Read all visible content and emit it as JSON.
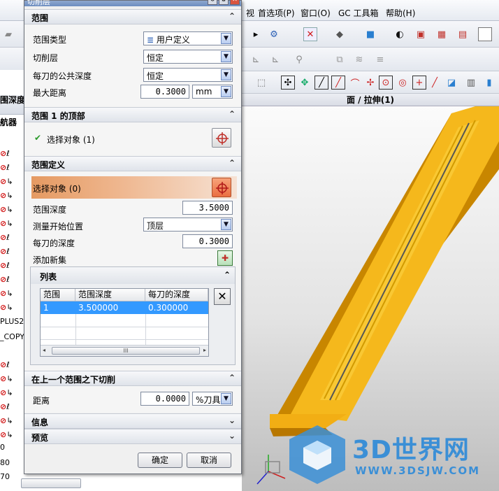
{
  "menubar": {
    "items": [
      "视",
      "首选项(P)",
      "窗口(O)",
      "GC 工具箱",
      "帮助(H)"
    ]
  },
  "view_title": "面 / 拉伸(1)",
  "navigator": {
    "tab1": "围深度",
    "tab2": "航器",
    "frag_plus": "PLUS2",
    "frag_copy": "_COPY",
    "num_a": "0",
    "num_b": "80",
    "num_c": "70"
  },
  "dialog": {
    "title": "切削层",
    "sections": {
      "range": {
        "title": "范围",
        "range_type_label": "范围类型",
        "range_type_value": "用户定义",
        "cut_layer_label": "切削层",
        "cut_layer_value": "恒定",
        "common_depth_label": "每刀的公共深度",
        "common_depth_value": "恒定",
        "max_distance_label": "最大距离",
        "max_distance_value": "0.3000",
        "max_distance_unit": "mm"
      },
      "range1_top": {
        "title": "范围 1 的顶部",
        "select_label": "选择对象 (1)"
      },
      "range_def": {
        "title": "范围定义",
        "select_label": "选择对象 (0)",
        "range_depth_label": "范围深度",
        "range_depth_value": "3.5000",
        "measure_from_label": "测量开始位置",
        "measure_from_value": "顶层",
        "depth_per_cut_label": "每刀的深度",
        "depth_per_cut_value": "0.3000",
        "add_new_label": "添加新集"
      },
      "list": {
        "title": "列表",
        "columns": [
          "范围",
          "范围深度",
          "每刀的深度"
        ],
        "rows": [
          {
            "range": "1",
            "depth": "3.500000",
            "per_cut": "0.300000"
          }
        ],
        "scroll_grip": "III"
      },
      "cut_below": {
        "title": "在上一个范围之下切削",
        "distance_label": "距离",
        "distance_value": "0.0000",
        "distance_unit": "%刀具"
      },
      "info": {
        "title": "信息"
      },
      "preview": {
        "title": "预览"
      }
    },
    "ok_label": "确定",
    "cancel_label": "取消"
  },
  "watermark": {
    "brand": "3D世界网",
    "url": "WWW.3DSJW.COM"
  },
  "colors": {
    "part_yellow": "#f5b81c",
    "part_dark": "#c88600",
    "active_select": "#e59a62",
    "table_select": "#3399ff",
    "watermark_blue": "#3b8fd6"
  }
}
